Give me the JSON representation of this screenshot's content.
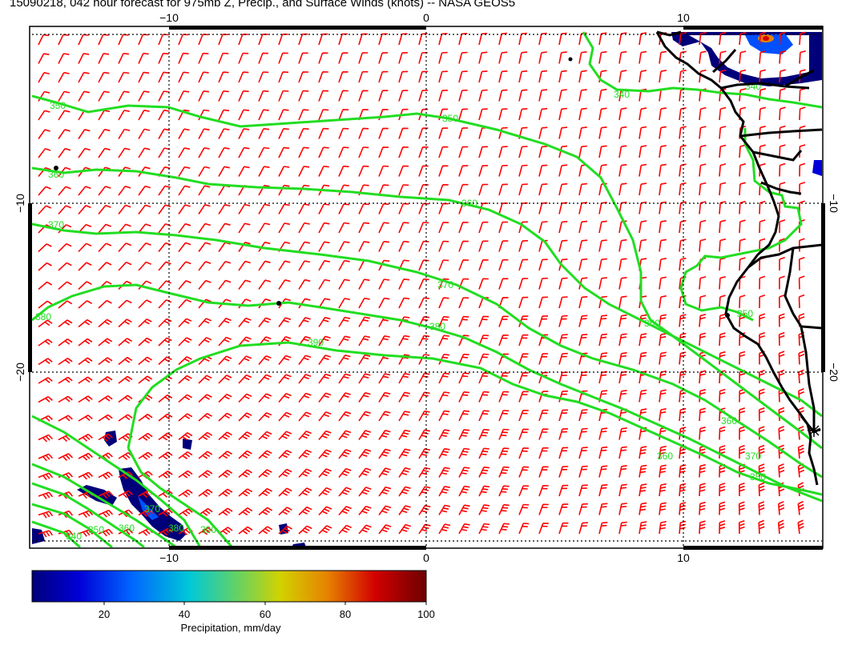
{
  "title": "15090218, 042 hour forecast for 975mb Z, Precip., and Surface Winds (knots) -- NASA GEOS5",
  "axes": {
    "x_ticks_top": [
      "−10",
      "0",
      "10"
    ],
    "x_ticks_bottom": [
      "−10",
      "0",
      "10"
    ],
    "y_ticks_left": [
      "−10",
      "−20"
    ],
    "y_ticks_right": [
      "−10",
      "−20"
    ]
  },
  "contour_labels": [
    "350",
    "360",
    "370",
    "380",
    "390",
    "340",
    "350",
    "360",
    "370",
    "380",
    "350",
    "360",
    "370",
    "350",
    "340",
    "350",
    "360",
    "370",
    "380",
    "390",
    "340",
    "350",
    "360"
  ],
  "colorbar": {
    "ticks": [
      "20",
      "40",
      "60",
      "80",
      "100"
    ],
    "label": "Precipitation, mm/day",
    "colors": [
      "#00007a",
      "#0000d8",
      "#0064ff",
      "#00c8d8",
      "#64d264",
      "#d2d200",
      "#e68200",
      "#d20000",
      "#6e0000"
    ]
  },
  "colors": {
    "wind_barbs": "#ff0000",
    "contours": "#22dd22",
    "coastline": "#000000",
    "grid": "#000000"
  },
  "chart_data": {
    "type": "map",
    "fields": [
      "975mb geopotential height contours",
      "precipitation (mm/day)",
      "surface wind barbs (knots)"
    ],
    "contour_levels": [
      340,
      350,
      360,
      370,
      380,
      390
    ],
    "colorbar_range": [
      0,
      100
    ],
    "colorbar_ticks": [
      20,
      40,
      60,
      80,
      100
    ],
    "gridlines": true
  }
}
